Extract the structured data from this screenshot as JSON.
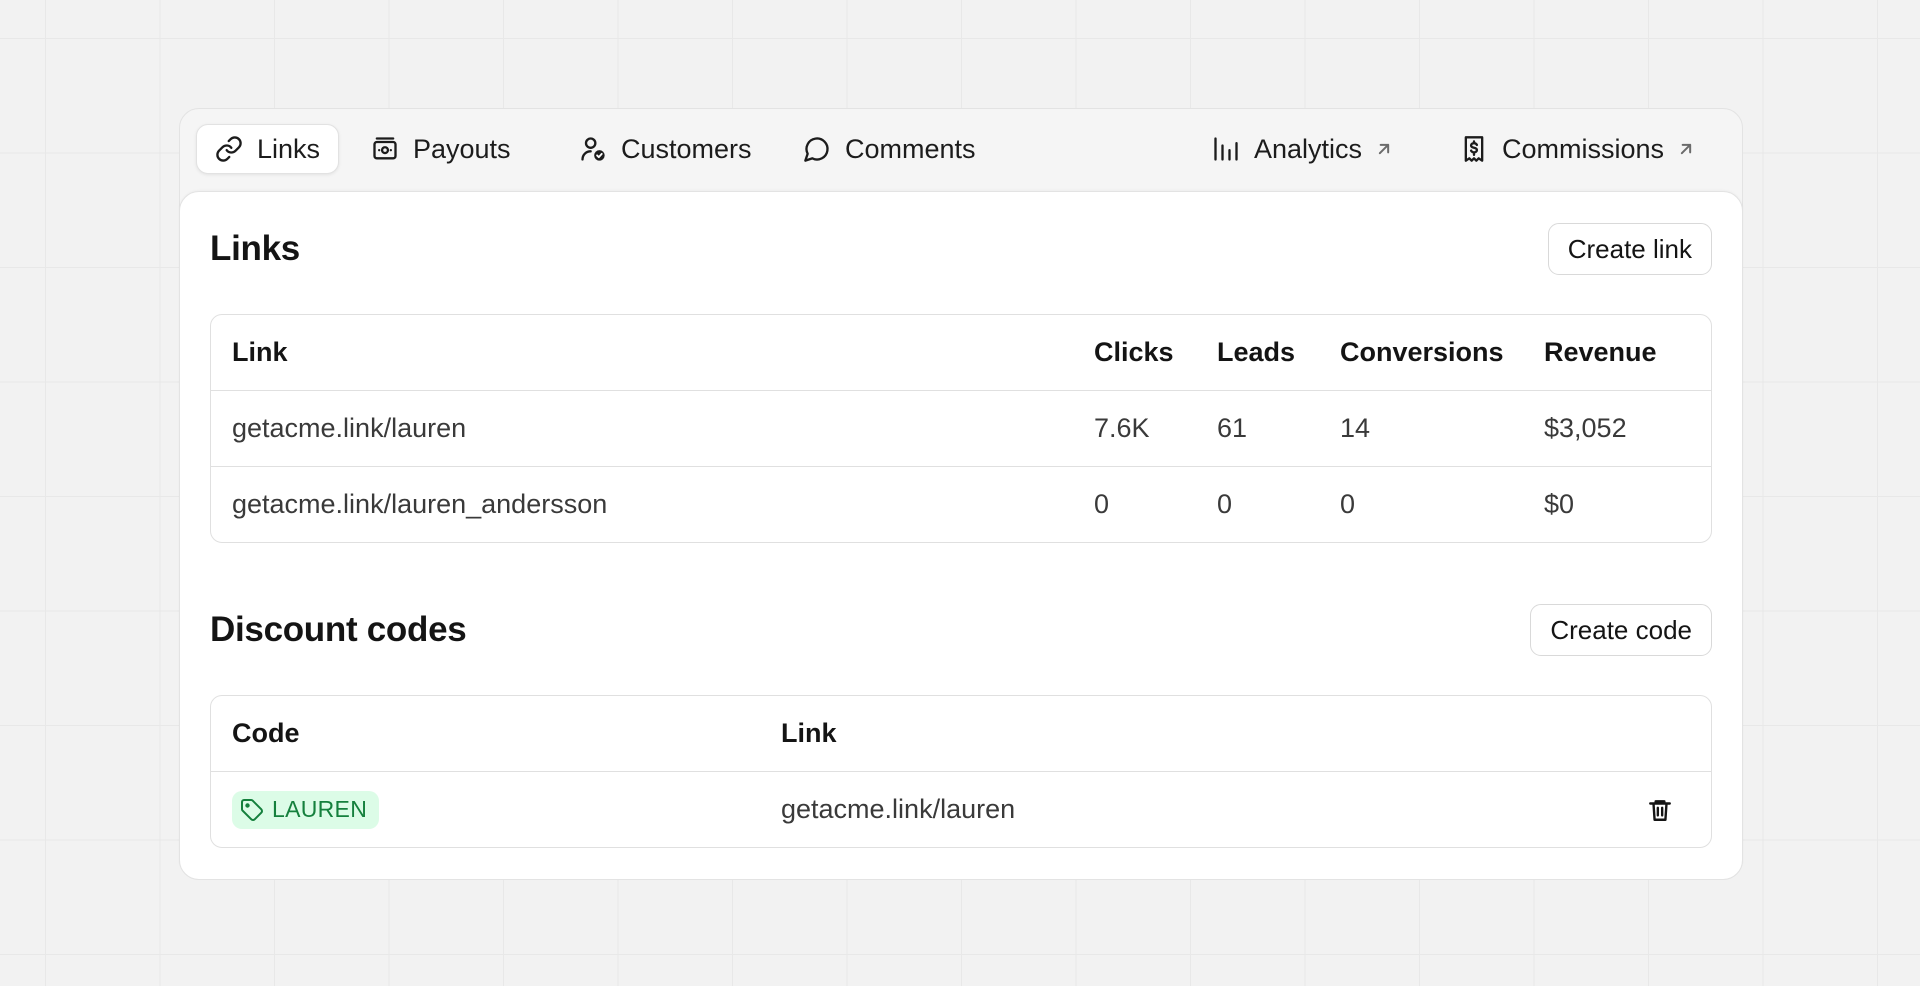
{
  "tabs": [
    {
      "label": "Links",
      "icon": "link-icon",
      "active": true
    },
    {
      "label": "Payouts",
      "icon": "money-icon"
    },
    {
      "label": "Customers",
      "icon": "user-check-icon"
    },
    {
      "label": "Comments",
      "icon": "message-icon"
    },
    {
      "label": "Analytics",
      "icon": "bar-chart-icon",
      "external": true
    },
    {
      "label": "Commissions",
      "icon": "receipt-dollar-icon",
      "external": true
    }
  ],
  "links_section": {
    "title": "Links",
    "create_label": "Create link",
    "columns": [
      "Link",
      "Clicks",
      "Leads",
      "Conversions",
      "Revenue"
    ],
    "rows": [
      [
        "getacme.link/lauren",
        "7.6K",
        "61",
        "14",
        "$3,052"
      ],
      [
        "getacme.link/lauren_andersson",
        "0",
        "0",
        "0",
        "$0"
      ]
    ]
  },
  "discount_section": {
    "title": "Discount codes",
    "create_label": "Create code",
    "columns": [
      "Code",
      "Link"
    ],
    "rows": [
      {
        "code": "LAUREN",
        "link": "getacme.link/lauren"
      }
    ]
  },
  "colors": {
    "badge_bg": "#dcfce7",
    "badge_text": "#15803d"
  }
}
